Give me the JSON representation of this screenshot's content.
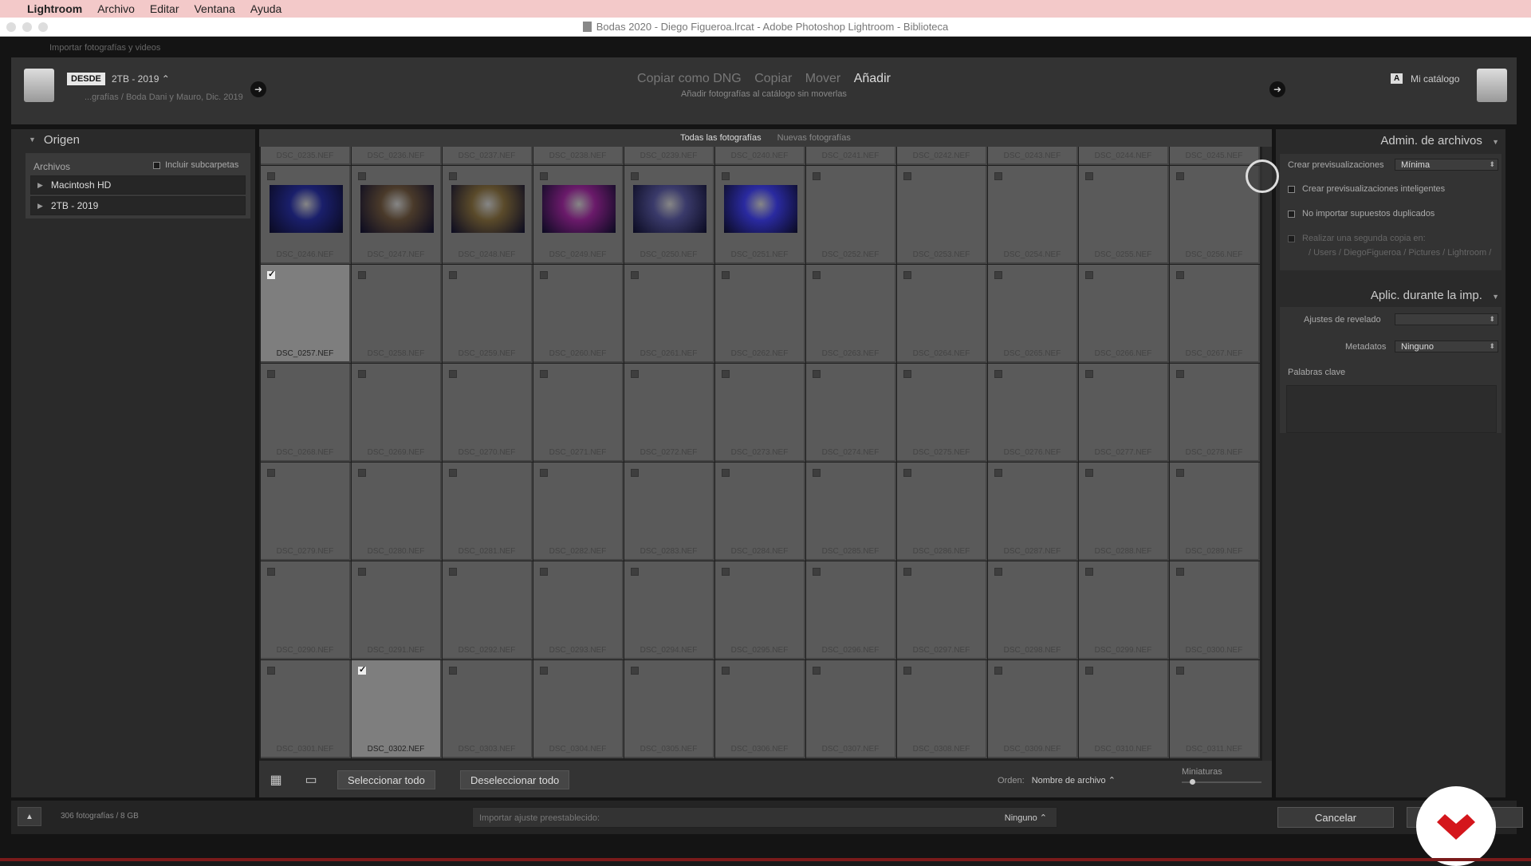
{
  "menubar": {
    "apple": "",
    "app": "Lightroom",
    "items": [
      "Archivo",
      "Editar",
      "Ventana",
      "Ayuda"
    ]
  },
  "titlebar": {
    "title": "Bodas 2020 - Diego Figueroa.lrcat - Adobe Photoshop Lightroom - Biblioteca"
  },
  "import_window": {
    "label": "Importar fotografías y videos"
  },
  "header": {
    "from_badge": "DESDE",
    "source_name": "2TB - 2019 ⌃",
    "source_path": "...grafías / Boda Dani y Mauro, Dic. 2019",
    "modes": [
      {
        "label": "Copiar como DNG",
        "active": false
      },
      {
        "label": "Copiar",
        "active": false
      },
      {
        "label": "Mover",
        "active": false
      },
      {
        "label": "Añadir",
        "active": true
      }
    ],
    "mode_subtitle": "Añadir fotografías al catálogo sin moverlas",
    "catalog_badge": "A",
    "catalog_name": "Mi catálogo"
  },
  "left_panel": {
    "title": "Origen",
    "files_label": "Archivos",
    "include_subfolders": "Incluir subcarpetas",
    "volumes": [
      "Macintosh HD",
      "2TB - 2019"
    ]
  },
  "center": {
    "tabs": [
      {
        "label": "Todas las fotografías",
        "active": true
      },
      {
        "label": "Nuevas fotografías",
        "active": false
      }
    ],
    "select_all": "Seleccionar todo",
    "deselect_all": "Deseleccionar todo",
    "sort_label": "Orden:",
    "sort_value": "Nombre de archivo ⌃",
    "thumbnails_label": "Miniaturas",
    "thumbnail_size": 0.1,
    "grid": {
      "columns": 11,
      "rows": [
        {
          "files": [
            "DSC_0235.NEF",
            "DSC_0236.NEF",
            "DSC_0237.NEF",
            "DSC_0238.NEF",
            "DSC_0239.NEF",
            "DSC_0240.NEF",
            "DSC_0241.NEF",
            "DSC_0242.NEF",
            "DSC_0243.NEF",
            "DSC_0244.NEF",
            "DSC_0245.NEF"
          ]
        },
        {
          "files": [
            "DSC_0246.NEF",
            "DSC_0247.NEF",
            "DSC_0248.NEF",
            "DSC_0249.NEF",
            "DSC_0250.NEF",
            "DSC_0251.NEF",
            "DSC_0252.NEF",
            "DSC_0253.NEF",
            "DSC_0254.NEF",
            "DSC_0255.NEF",
            "DSC_0256.NEF"
          ]
        },
        {
          "files": [
            "DSC_0257.NEF",
            "DSC_0258.NEF",
            "DSC_0259.NEF",
            "DSC_0260.NEF",
            "DSC_0261.NEF",
            "DSC_0262.NEF",
            "DSC_0263.NEF",
            "DSC_0264.NEF",
            "DSC_0265.NEF",
            "DSC_0266.NEF",
            "DSC_0267.NEF"
          ]
        },
        {
          "files": [
            "DSC_0268.NEF",
            "DSC_0269.NEF",
            "DSC_0270.NEF",
            "DSC_0271.NEF",
            "DSC_0272.NEF",
            "DSC_0273.NEF",
            "DSC_0274.NEF",
            "DSC_0275.NEF",
            "DSC_0276.NEF",
            "DSC_0277.NEF",
            "DSC_0278.NEF"
          ]
        },
        {
          "files": [
            "DSC_0279.NEF",
            "DSC_0280.NEF",
            "DSC_0281.NEF",
            "DSC_0282.NEF",
            "DSC_0283.NEF",
            "DSC_0284.NEF",
            "DSC_0285.NEF",
            "DSC_0286.NEF",
            "DSC_0287.NEF",
            "DSC_0288.NEF",
            "DSC_0289.NEF"
          ]
        },
        {
          "files": [
            "DSC_0290.NEF",
            "DSC_0291.NEF",
            "DSC_0292.NEF",
            "DSC_0293.NEF",
            "DSC_0294.NEF",
            "DSC_0295.NEF",
            "DSC_0296.NEF",
            "DSC_0297.NEF",
            "DSC_0298.NEF",
            "DSC_0299.NEF",
            "DSC_0300.NEF"
          ]
        },
        {
          "files": [
            "DSC_0301.NEF",
            "DSC_0302.NEF",
            "DSC_0303.NEF",
            "DSC_0304.NEF",
            "DSC_0305.NEF",
            "DSC_0306.NEF",
            "DSC_0307.NEF",
            "DSC_0308.NEF",
            "DSC_0309.NEF",
            "DSC_0310.NEF",
            "DSC_0311.NEF"
          ]
        }
      ],
      "checked": [
        "DSC_0257.NEF",
        "DSC_0302.NEF"
      ],
      "thumbnails": {
        "DSC_0246.NEF": "#1a1f6b",
        "DSC_0247.NEF": "#4a3a2a",
        "DSC_0248.NEF": "#5a4a2a",
        "DSC_0249.NEF": "#6a1a6a",
        "DSC_0250.NEF": "#3a3a6a",
        "DSC_0251.NEF": "#2a2aa0"
      }
    }
  },
  "right_panel": {
    "file_handling_title": "Admin. de archivos",
    "previews_label": "Crear previsualizaciones",
    "previews_value": "Mínima",
    "smart_previews": "Crear previsualizaciones inteligentes",
    "no_duplicates": "No importar supuestos duplicados",
    "second_copy": "Realizar una segunda copia en:",
    "second_copy_path": "/ Users / DiegoFigueroa / Pictures / Lightroom /",
    "apply_title": "Aplic. durante la imp.",
    "develop_label": "Ajustes de revelado",
    "develop_value": "",
    "metadata_label": "Metadatos",
    "metadata_value": "Ninguno",
    "keywords_label": "Palabras clave"
  },
  "bottom": {
    "count": "306 fotografías / 8 GB",
    "preset_label": "Importar ajuste preestablecido:",
    "preset_value": "Ninguno ⌃",
    "cancel": "Cancelar"
  }
}
